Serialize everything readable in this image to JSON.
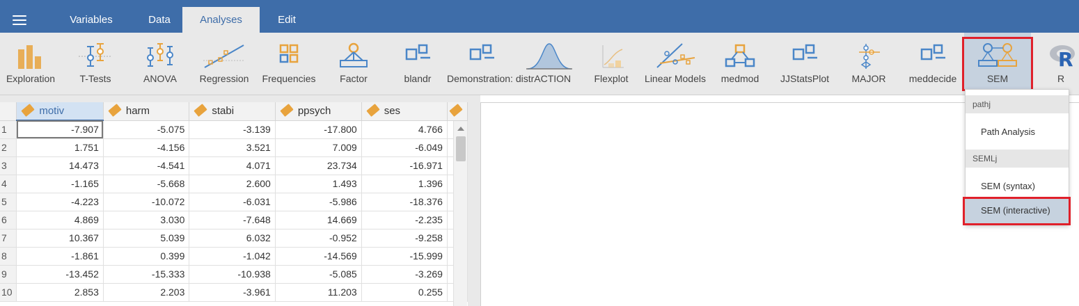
{
  "menubar": {
    "tabs": [
      {
        "label": "Variables"
      },
      {
        "label": "Data"
      },
      {
        "label": "Analyses"
      },
      {
        "label": "Edit"
      }
    ]
  },
  "ribbon": {
    "buttons": [
      {
        "label": "Exploration",
        "icon": "exploration-bars-icon"
      },
      {
        "label": "T-Tests",
        "icon": "t-tests-icon"
      },
      {
        "label": "ANOVA",
        "icon": "anova-icon"
      },
      {
        "label": "Regression",
        "icon": "regression-icon"
      },
      {
        "label": "Frequencies",
        "icon": "frequencies-icon"
      },
      {
        "label": "Factor",
        "icon": "factor-icon"
      },
      {
        "label": "blandr",
        "icon": "module-squares-icon"
      },
      {
        "label": "Demonstration: distrACTION",
        "icon": "module-squares-icon"
      },
      {
        "label": "",
        "icon": "normal-curve-icon"
      },
      {
        "label": "Flexplot",
        "icon": "flexplot-icon"
      },
      {
        "label": "Linear Models",
        "icon": "linear-models-icon"
      },
      {
        "label": "medmod",
        "icon": "medmod-icon"
      },
      {
        "label": "JJStatsPlot",
        "icon": "module-squares-icon"
      },
      {
        "label": "MAJOR",
        "icon": "major-icon"
      },
      {
        "label": "meddecide",
        "icon": "module-squares-icon"
      },
      {
        "label": "SEM",
        "icon": "sem-icon"
      },
      {
        "label": "R",
        "icon": "r-logo-icon"
      }
    ]
  },
  "grid": {
    "columns": [
      "motiv",
      "harm",
      "stabi",
      "ppsych",
      "ses"
    ],
    "rows": [
      {
        "n": "1",
        "cells": [
          "-7.907",
          "-5.075",
          "-3.139",
          "-17.800",
          "4.766"
        ]
      },
      {
        "n": "2",
        "cells": [
          "1.751",
          "-4.156",
          "3.521",
          "7.009",
          "-6.049"
        ]
      },
      {
        "n": "3",
        "cells": [
          "14.473",
          "-4.541",
          "4.071",
          "23.734",
          "-16.971"
        ]
      },
      {
        "n": "4",
        "cells": [
          "-1.165",
          "-5.668",
          "2.600",
          "1.493",
          "1.396"
        ]
      },
      {
        "n": "5",
        "cells": [
          "-4.223",
          "-10.072",
          "-6.031",
          "-5.986",
          "-18.376"
        ]
      },
      {
        "n": "6",
        "cells": [
          "4.869",
          "3.030",
          "-7.648",
          "14.669",
          "-2.235"
        ]
      },
      {
        "n": "7",
        "cells": [
          "10.367",
          "5.039",
          "6.032",
          "-0.952",
          "-9.258"
        ]
      },
      {
        "n": "8",
        "cells": [
          "-1.861",
          "0.399",
          "-1.042",
          "-14.569",
          "-15.999"
        ]
      },
      {
        "n": "9",
        "cells": [
          "-13.452",
          "-15.333",
          "-10.938",
          "-5.085",
          "-3.269"
        ]
      },
      {
        "n": "10",
        "cells": [
          "2.853",
          "2.203",
          "-3.961",
          "11.203",
          "0.255"
        ]
      }
    ]
  },
  "dropdown": {
    "groups": [
      {
        "header": "pathj",
        "items": [
          "Path Analysis"
        ]
      },
      {
        "header": "SEMLj",
        "items": [
          "SEM (syntax)",
          "SEM (interactive)"
        ]
      }
    ]
  },
  "colors": {
    "menubar": "#3e6da9",
    "ribbon": "#e9e9e9",
    "highlight": "#e0202a",
    "icon_blue": "#4a86c8",
    "icon_orange": "#e8a33d"
  }
}
